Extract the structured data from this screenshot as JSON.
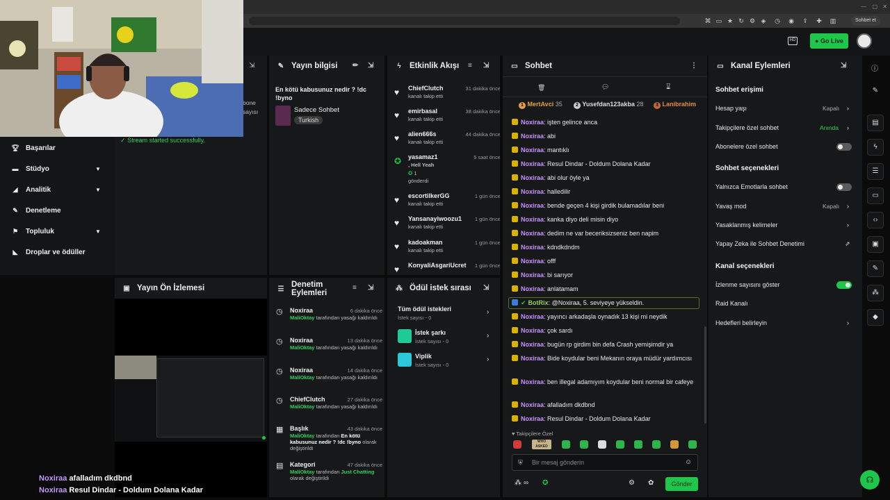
{
  "browser": {
    "profile_label": "Sohbet et"
  },
  "topnav": {
    "golive_label": "Go Live"
  },
  "leftnav": {
    "items": [
      {
        "label": "Başarılar",
        "icon": "trophy-icon"
      },
      {
        "label": "Stüdyo",
        "icon": "studio-icon"
      },
      {
        "label": "Analitik",
        "icon": "analytics-icon"
      },
      {
        "label": "Denetleme",
        "icon": "wrench-icon"
      },
      {
        "label": "Topluluk",
        "icon": "community-icon"
      },
      {
        "label": "Droplar ve ödüller",
        "icon": "drops-icon"
      }
    ],
    "partial_text": [
      "bone",
      "sayısı"
    ]
  },
  "stream_status": "Stream started successfully.",
  "yayin_bilgisi": {
    "title": "Yayın bilgisi",
    "stream_title": "En kötü kabusunuz nedir ? !dc !byno",
    "category": "Sadece Sohbet",
    "tag": "Turkish"
  },
  "preview": {
    "title": "Yayın Ön İzlemesi"
  },
  "activity": {
    "title": "Etkinlik Akışı",
    "items": [
      {
        "name": "ChiefClutch",
        "sub": "kanalı takip etti",
        "time": "31 dakika önce"
      },
      {
        "name": "emirbasal",
        "sub": "kanalı takip etti",
        "time": "38 dakika önce"
      },
      {
        "name": "alien666s",
        "sub": "kanalı takip etti",
        "time": "44 dakika önce"
      },
      {
        "name": "yasamaz1",
        "sub": ", Hell Yeah",
        "sub2": "1",
        "sub3": "gönderdi",
        "time": "5 saat önce"
      },
      {
        "name": "escortilkerGG",
        "sub": "kanalı takip etti",
        "time": "1 gün önce"
      },
      {
        "name": "Yansanayiwoozu1",
        "sub": "kanalı takip etti",
        "time": "1 gün önce"
      },
      {
        "name": "kadoakman",
        "sub": "kanalı takip etti",
        "time": "1 gün önce"
      },
      {
        "name": "KonyaliAsgariUcret",
        "sub": "",
        "time": "1 gün önce"
      }
    ]
  },
  "moderation": {
    "title": "Denetim Eylemleri",
    "items": [
      {
        "name": "Noxiraa",
        "time": "6 dakika önce",
        "who": "MaliOktay",
        "pre": "tarafından yasağı kaldırıldı",
        "mid": "",
        "post": ""
      },
      {
        "name": "Noxiraa",
        "time": "13 dakika önce",
        "who": "MaliOktay",
        "pre": "tarafından yasağı kaldırıldı",
        "mid": "",
        "post": ""
      },
      {
        "name": "Noxiraa",
        "time": "14 dakika önce",
        "who": "MaliOktay",
        "pre": "tarafından yasağı kaldırıldı",
        "mid": "",
        "post": ""
      },
      {
        "name": "ChiefClutch",
        "time": "27 dakika önce",
        "who": "MaliOktay",
        "pre": "tarafından yasağı kaldırıldı",
        "mid": "",
        "post": ""
      },
      {
        "name": "Başlık",
        "time": "43 dakika önce",
        "who": "MaliOktay",
        "pre": "tarafından",
        "mid": "En kötü kabusunuz nedir ? !dc !byno",
        "post": "olarak değiştirildi"
      },
      {
        "name": "Kategori",
        "time": "47 dakika önce",
        "who": "MaliOktay",
        "pre": "tarafından",
        "mid": "Just Chatting",
        "post": "olarak değiştirildi"
      }
    ]
  },
  "rewards": {
    "title": "Ödül istek sırası",
    "items": [
      {
        "name": "Tüm ödül istekleri",
        "sub": "İstek sayısı - 0"
      },
      {
        "name": "İstek şarkı",
        "sub": "İstek sayısı - 0"
      },
      {
        "name": "Viplik",
        "sub": "İstek sayısı - 0"
      }
    ]
  },
  "chat": {
    "title": "Sohbet",
    "top": [
      {
        "name": "MertAvci",
        "count": "35",
        "rank": "1"
      },
      {
        "name": "Yusefdan123akba",
        "count": "28",
        "rank": "2"
      },
      {
        "name": "Lanibrahim",
        "count": "",
        "rank": "3"
      }
    ],
    "messages": [
      {
        "user": "Noxiraa",
        "text": "işten gelince anca"
      },
      {
        "user": "Noxiraa",
        "text": "abi"
      },
      {
        "user": "Noxiraa",
        "text": "mantıklı"
      },
      {
        "user": "Noxiraa",
        "text": "Resul Dindar - Doldum Dolana Kadar"
      },
      {
        "user": "Noxiraa",
        "text": "abi olur öyle ya"
      },
      {
        "user": "Noxiraa",
        "text": "halledilir"
      },
      {
        "user": "Noxiraa",
        "text": "bende geçen 4 kişi girdik bulamadılar beni"
      },
      {
        "user": "Noxiraa",
        "text": "kanka diyo deli misin diyo"
      },
      {
        "user": "Noxiraa",
        "text": "dedim ne var beceriksizseniz ben napim"
      },
      {
        "user": "Noxiraa",
        "text": "kdndkdndm"
      },
      {
        "user": "Noxiraa",
        "text": "offf"
      },
      {
        "user": "Noxiraa",
        "text": "bi sarıyor"
      },
      {
        "user": "Noxiraa",
        "text": "anlatamam"
      },
      {
        "user": "BotRix",
        "text": "@Noxiraa, 5. seviyeye yükseldin."
      },
      {
        "user": "Noxiraa",
        "text": "yayıncı arkadaşla oynadık 13 kişi mi neydik"
      },
      {
        "user": "Noxiraa",
        "text": "çok sardı"
      },
      {
        "user": "Noxiraa",
        "text": "bugün rp girdim bin defa Crash yemişimdir ya"
      },
      {
        "user": "Noxiraa",
        "text": "Bide koydular beni Mekanın oraya müdür yardımcısı"
      },
      {
        "user": "Noxiraa",
        "text": "ben illegal adamıyım koydular beni normal bir cafeye"
      },
      {
        "user": "Noxiraa",
        "text": "afalladım dkdbnd"
      },
      {
        "user": "Noxiraa",
        "text": "Resul Dindar - Doldum Dolana Kadar"
      }
    ],
    "followers_only": "Takipçilere Özel",
    "emote_text": "WHO ASKED",
    "input_placeholder": "Bir mesaj gönderin",
    "send_label": "Gönder"
  },
  "channel": {
    "title": "Kanal Eylemleri",
    "sec1": "Sohbet erişimi",
    "hesap": {
      "label": "Hesap yaşı",
      "value": "Kapalı"
    },
    "takipci": {
      "label": "Takipçilere özel sohbet",
      "value": "Anında"
    },
    "abone": "Abonelere özel sohbet",
    "sec2": "Sohbet seçenekleri",
    "emote": "Yalnızca Emotlarla sohbet",
    "yavas": {
      "label": "Yavaş mod",
      "value": "Kapalı"
    },
    "yasakli": "Yasaklanmış kelimeler",
    "yapay": "Yapay Zeka ile Sohbet Denetimi",
    "sec3": "Kanal seçenekleri",
    "izlenme": "İzlenme sayısını göster",
    "raid": "Raid Kanalı",
    "hedef": "Hedefleri belirleyin"
  },
  "overlay": [
    {
      "user": "Noxiraa",
      "text": "afalladım dkdbnd"
    },
    {
      "user": "Noxiraa",
      "text": "Resul Dindar - Doldum Dolana Kadar"
    }
  ],
  "colors": {
    "accent": "#1ec74b",
    "user": "#c690ff",
    "bg": "#0b0b0c",
    "panel": "#17181a"
  }
}
